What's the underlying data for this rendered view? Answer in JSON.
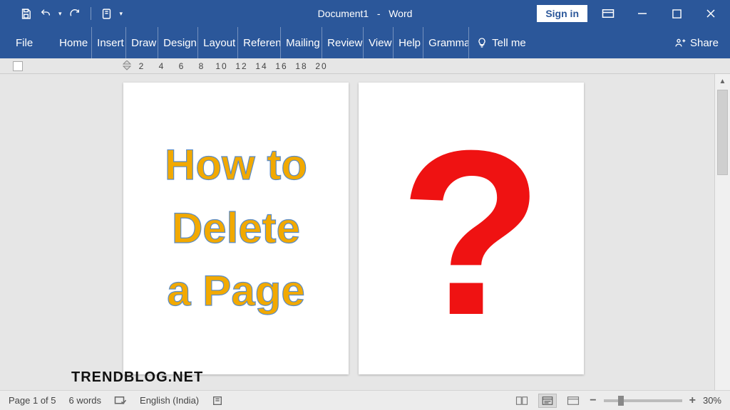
{
  "titlebar": {
    "document_name": "Document1",
    "app_name": "Word",
    "signin": "Sign in"
  },
  "ribbon": {
    "file": "File",
    "tabs": [
      "Home",
      "Insert",
      "Draw",
      "Design",
      "Layout",
      "Referen",
      "Mailing",
      "Review",
      "View",
      "Help",
      "Gramma"
    ],
    "tellme": "Tell me",
    "share": "Share"
  },
  "ruler": {
    "marks": [
      "2",
      "4",
      "6",
      "8",
      "10",
      "12",
      "14",
      "16",
      "18",
      "20"
    ]
  },
  "pages": {
    "page1_lines": [
      "How to",
      "Delete",
      "a Page"
    ],
    "page2_glyph": "?"
  },
  "statusbar": {
    "page": "Page 1 of 5",
    "words": "6 words",
    "language": "English (India)",
    "zoom": "30%"
  },
  "watermark": "TRENDBLOG.NET"
}
